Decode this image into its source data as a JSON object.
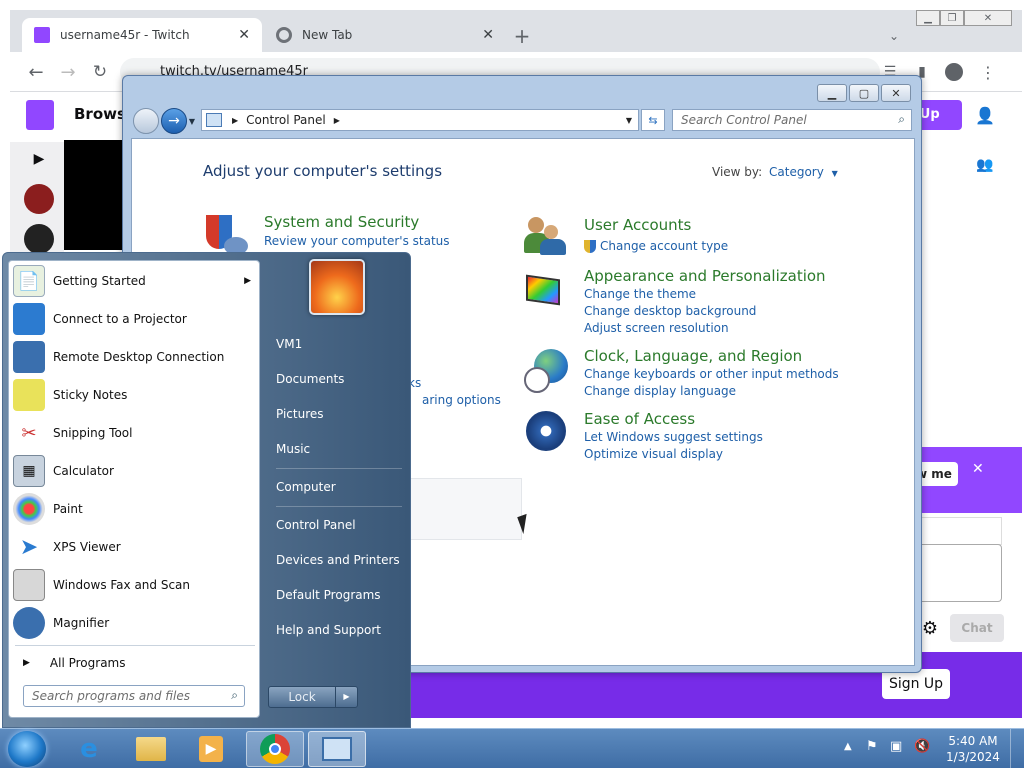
{
  "browser": {
    "tabs": [
      {
        "title": "username45r - Twitch",
        "active": true
      },
      {
        "title": "New Tab",
        "active": false
      }
    ],
    "url": "twitch.tv/username45r"
  },
  "twitch": {
    "browse": "Browse",
    "signup_top": "n Up",
    "follow_partial": "w me",
    "chat_label": "Chat",
    "signup_bottom": "Sign Up"
  },
  "control_panel": {
    "breadcrumb": "Control Panel",
    "search_placeholder": "Search Control Panel",
    "heading": "Adjust your computer's settings",
    "view_by_label": "View by:",
    "view_by_value": "Category",
    "categories": [
      {
        "title": "System and Security",
        "links": [
          "Review your computer's status"
        ]
      },
      {
        "title": "User Accounts",
        "links": [
          "Change account type"
        ]
      },
      {
        "title": "Appearance and Personalization",
        "links": [
          "Change the theme",
          "Change desktop background",
          "Adjust screen resolution"
        ]
      },
      {
        "title": "Clock, Language, and Region",
        "links": [
          "Change keyboards or other input methods",
          "Change display language"
        ]
      },
      {
        "title": "Ease of Access",
        "links": [
          "Let Windows suggest settings",
          "Optimize visual display"
        ]
      }
    ],
    "partial_links": [
      "ks",
      "aring options"
    ]
  },
  "start_menu": {
    "programs": [
      "Getting Started",
      "Connect to a Projector",
      "Remote Desktop Connection",
      "Sticky Notes",
      "Snipping Tool",
      "Calculator",
      "Paint",
      "XPS Viewer",
      "Windows Fax and Scan",
      "Magnifier"
    ],
    "all_programs": "All Programs",
    "search_placeholder": "Search programs and files",
    "right_items": [
      "VM1",
      "Documents",
      "Pictures",
      "Music",
      "Computer",
      "Control Panel",
      "Devices and Printers",
      "Default Programs",
      "Help and Support"
    ],
    "lock_label": "Lock"
  },
  "taskbar": {
    "time": "5:40 AM",
    "date": "1/3/2024"
  },
  "colors": {
    "twitch_purple": "#9147ff",
    "link_blue": "#1e5fa8",
    "category_green": "#2b7a2b"
  }
}
